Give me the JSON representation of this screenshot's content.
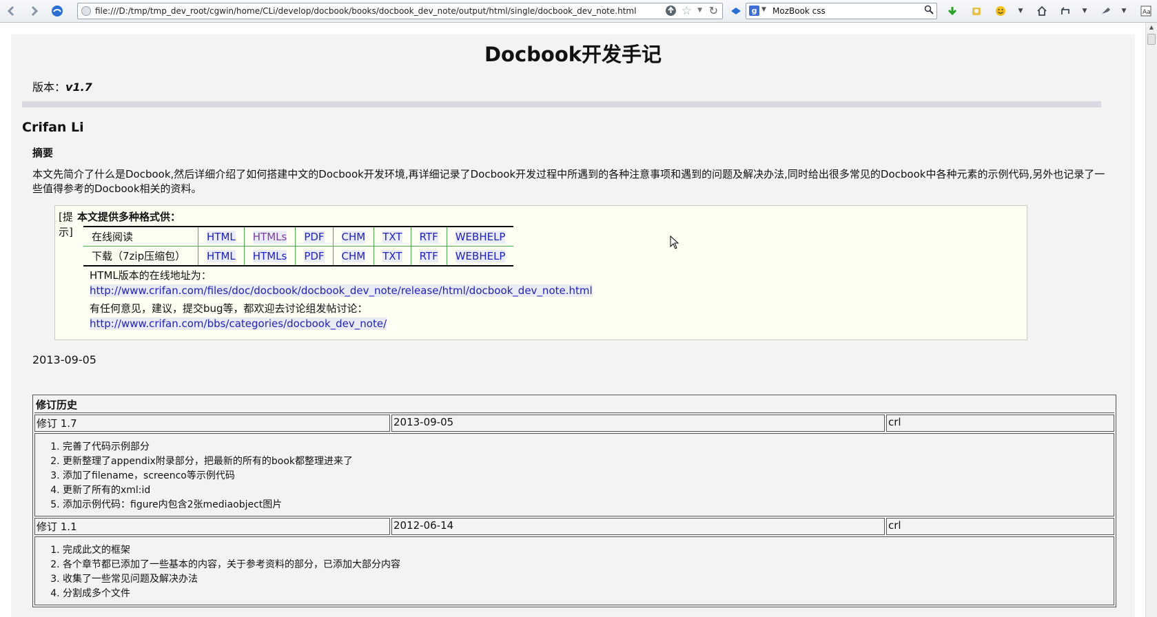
{
  "browser": {
    "url": "file:///D:/tmp/tmp_dev_root/cgwin/home/CLi/develop/docbook/books/docbook_dev_note/output/html/single/docbook_dev_note.html",
    "search_text": "MozBook css",
    "icons": [
      "back-icon",
      "forward-icon",
      "persona-icon",
      "go-icon",
      "bookmark-star-icon",
      "reload-icon",
      "dropdown-icon",
      "magnifier-icon",
      "download-icon",
      "addon-icon",
      "smiley-icon",
      "home-icon",
      "undo-icon",
      "tools-icon",
      "ime-icon"
    ]
  },
  "doc": {
    "title": "Docbook开发手记",
    "version_label": "版本：",
    "version_value": "v1.7",
    "author": "Crifan Li",
    "abstract_title": "摘要",
    "abstract_text": "本文先简介了什么是Docbook,然后详细介绍了如何搭建中文的Docbook开发环境,再详细记录了Docbook开发过程中所遇到的各种注意事项和遇到的问题及解决办法,同时给出很多常见的Docbook中各种元素的示例代码,另外也记录了一些值得参考的Docbook相关的资料。",
    "tip": {
      "label": "[提示]",
      "heading": "本文提供多种格式供：",
      "rows": [
        {
          "label": "在线阅读",
          "formats": [
            "HTML",
            "HTMLs",
            "PDF",
            "CHM",
            "TXT",
            "RTF",
            "WEBHELP"
          ]
        },
        {
          "label": "下载（7zip压缩包）",
          "formats": [
            "HTML",
            "HTMLs",
            "PDF",
            "CHM",
            "TXT",
            "RTF",
            "WEBHELP"
          ]
        }
      ],
      "online_label": "HTML版本的在线地址为：",
      "online_url": "http://www.crifan.com/files/doc/docbook/docbook_dev_note/release/html/docbook_dev_note.html",
      "feedback_label": "有任何意见，建议，提交bug等，都欢迎去讨论组发帖讨论：",
      "feedback_url": "http://www.crifan.com/bbs/categories/docbook_dev_note/"
    },
    "date": "2013-09-05",
    "revision": {
      "title": "修订历史",
      "entries": [
        {
          "rev": "修订 1.7",
          "date": "2013-09-05",
          "author": "crl",
          "notes": [
            "完善了代码示例部分",
            "更新整理了appendix附录部分，把最新的所有的book都整理进来了",
            "添加了filename，screenco等示例代码",
            "更新了所有的xml:id",
            "添加示例代码：figure内包含2张mediaobject图片"
          ]
        },
        {
          "rev": "修订 1.1",
          "date": "2012-06-14",
          "author": "crl",
          "notes": [
            "完成此文的框架",
            "各个章节都已添加了一些基本的内容，关于参考资料的部分，已添加大部分内容",
            "收集了一些常见问题及解决办法",
            "分割成多个文件"
          ]
        }
      ]
    }
  }
}
